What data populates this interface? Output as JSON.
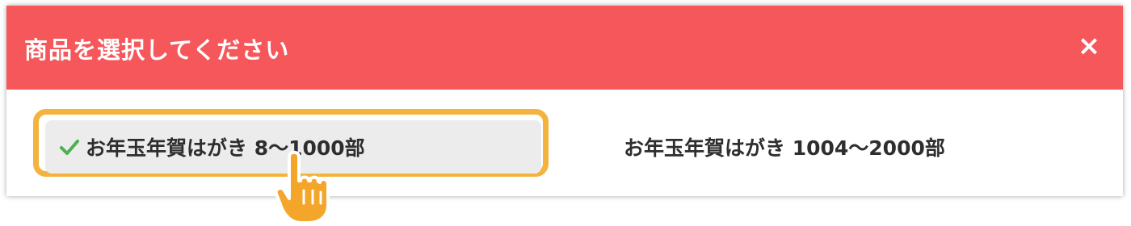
{
  "dialog": {
    "title": "商品を選択してください",
    "close_label": "×",
    "header_color": "#f5575b"
  },
  "options": [
    {
      "label": "お年玉年賀はがき 8〜1000部",
      "selected": true
    },
    {
      "label": "お年玉年賀はがき 1004〜2000部",
      "selected": false
    }
  ],
  "colors": {
    "highlight": "#f4b23e",
    "check": "#4caf50",
    "selected_bg": "#ececec"
  },
  "icons": {
    "check": "check-icon",
    "close": "close-icon",
    "pointer": "hand-pointer-icon"
  }
}
